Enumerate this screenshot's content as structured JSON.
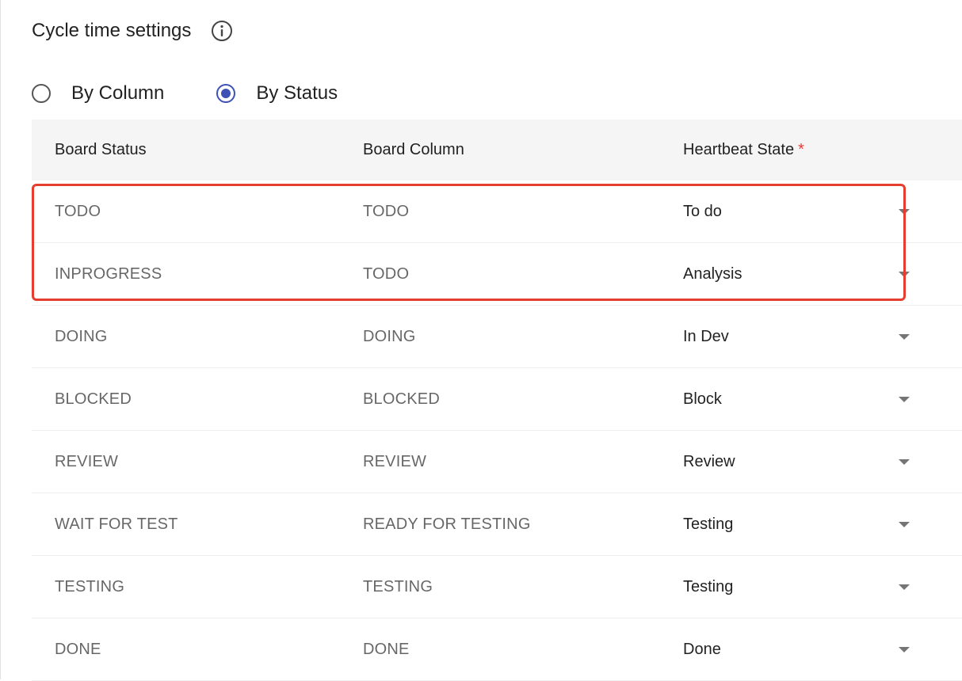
{
  "title": "Cycle time settings",
  "icons": {
    "info": "info-circle-icon",
    "dropdown": "dropdown-arrow-icon"
  },
  "radio": {
    "options": [
      {
        "label": "By Column",
        "selected": false
      },
      {
        "label": "By Status",
        "selected": true
      }
    ]
  },
  "table": {
    "headers": [
      "Board Status",
      "Board Column",
      "Heartbeat State"
    ],
    "required_mark": "*",
    "rows": [
      {
        "status": "TODO",
        "column": "TODO",
        "state": "To do"
      },
      {
        "status": "INPROGRESS",
        "column": "TODO",
        "state": "Analysis"
      },
      {
        "status": "DOING",
        "column": "DOING",
        "state": "In Dev"
      },
      {
        "status": "BLOCKED",
        "column": "BLOCKED",
        "state": "Block"
      },
      {
        "status": "REVIEW",
        "column": "REVIEW",
        "state": "Review"
      },
      {
        "status": "WAIT FOR TEST",
        "column": "READY FOR TESTING",
        "state": "Testing"
      },
      {
        "status": "TESTING",
        "column": "TESTING",
        "state": "Testing"
      },
      {
        "status": "DONE",
        "column": "DONE",
        "state": "Done"
      }
    ]
  },
  "colors": {
    "accent": "#3f51b5",
    "highlight": "#e53e30",
    "required": "#e53935",
    "header_bg": "#f5f5f5"
  }
}
